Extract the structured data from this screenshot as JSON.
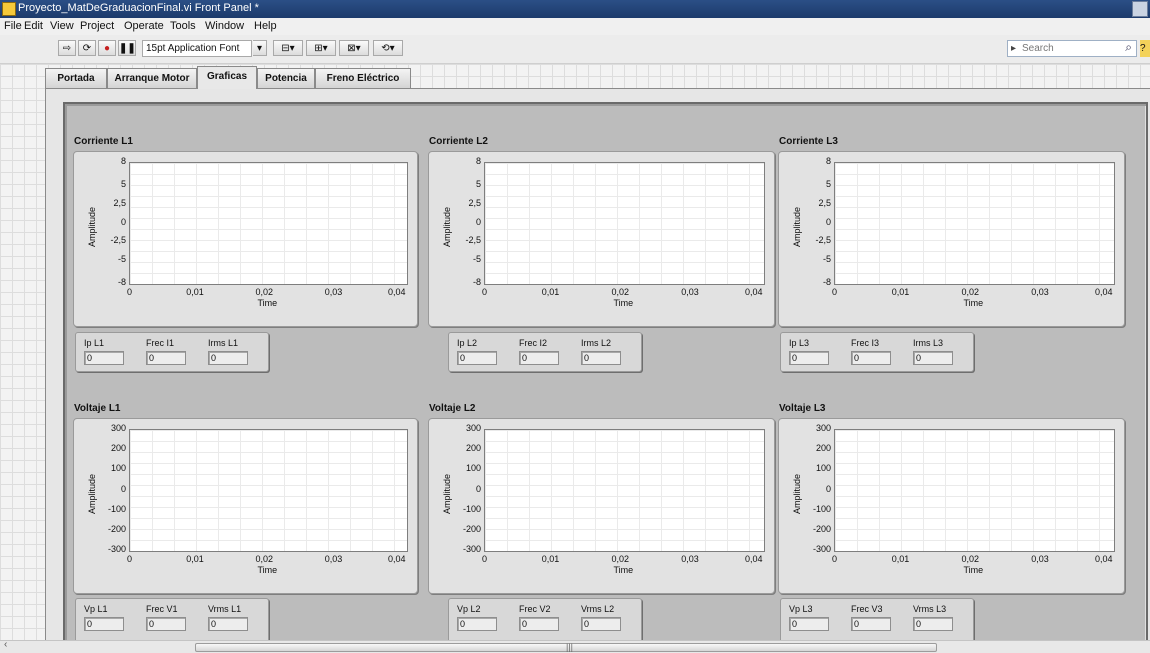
{
  "window": {
    "title": "Proyecto_MatDeGraduacionFinal.vi Front Panel *"
  },
  "menu": [
    "File",
    "Edit",
    "View",
    "Project",
    "Operate",
    "Tools",
    "Window",
    "Help"
  ],
  "toolbar": {
    "font": "15pt Application Font",
    "search_placeholder": "Search"
  },
  "tabs": [
    "Portada",
    "Arranque Motor",
    "Graficas",
    "Potencia",
    "Freno Eléctrico"
  ],
  "active_tab": "Graficas",
  "ticks": {
    "x": [
      "0",
      "0,01",
      "0,02",
      "0,03",
      "0,04"
    ],
    "y_current": [
      "8",
      "5",
      "2,5",
      "0",
      "-2,5",
      "-5",
      "-8"
    ],
    "y_voltage": [
      "300",
      "200",
      "100",
      "0",
      "-100",
      "-200",
      "-300"
    ],
    "xlabel": "Time",
    "ylabel": "Amplitude"
  },
  "current_graphs": [
    {
      "title": "Corriente L1",
      "labels": [
        "Ip L1",
        "Frec I1",
        "Irms L1"
      ],
      "values": [
        "0",
        "0",
        "0"
      ]
    },
    {
      "title": "Corriente L2",
      "labels": [
        "Ip L2",
        "Frec I2",
        "Irms L2"
      ],
      "values": [
        "0",
        "0",
        "0"
      ]
    },
    {
      "title": "Corriente L3",
      "labels": [
        "Ip L3",
        "Frec I3",
        "Irms L3"
      ],
      "values": [
        "0",
        "0",
        "0"
      ]
    }
  ],
  "voltage_graphs": [
    {
      "title": "Voltaje L1",
      "labels": [
        "Vp L1",
        "Frec V1",
        "Vrms L1"
      ],
      "values": [
        "0",
        "0",
        "0"
      ]
    },
    {
      "title": "Voltaje L2",
      "labels": [
        "Vp L2",
        "Frec V2",
        "Vrms L2"
      ],
      "values": [
        "0",
        "0",
        "0"
      ]
    },
    {
      "title": "Voltaje L3",
      "labels": [
        "Vp L3",
        "Frec V3",
        "Vrms L3"
      ],
      "values": [
        "0",
        "0",
        "0"
      ]
    }
  ],
  "chart_data": [
    {
      "type": "line",
      "title": "Corriente L1",
      "xlabel": "Time",
      "ylabel": "Amplitude",
      "xlim": [
        0,
        0.04
      ],
      "ylim": [
        -8,
        8
      ],
      "series": []
    },
    {
      "type": "line",
      "title": "Corriente L2",
      "xlabel": "Time",
      "ylabel": "Amplitude",
      "xlim": [
        0,
        0.04
      ],
      "ylim": [
        -8,
        8
      ],
      "series": []
    },
    {
      "type": "line",
      "title": "Corriente L3",
      "xlabel": "Time",
      "ylabel": "Amplitude",
      "xlim": [
        0,
        0.04
      ],
      "ylim": [
        -8,
        8
      ],
      "series": []
    },
    {
      "type": "line",
      "title": "Voltaje L1",
      "xlabel": "Time",
      "ylabel": "Amplitude",
      "xlim": [
        0,
        0.04
      ],
      "ylim": [
        -300,
        300
      ],
      "series": []
    },
    {
      "type": "line",
      "title": "Voltaje L2",
      "xlabel": "Time",
      "ylabel": "Amplitude",
      "xlim": [
        0,
        0.04
      ],
      "ylim": [
        -300,
        300
      ],
      "series": []
    },
    {
      "type": "line",
      "title": "Voltaje L3",
      "xlabel": "Time",
      "ylabel": "Amplitude",
      "xlim": [
        0,
        0.04
      ],
      "ylim": [
        -300,
        300
      ],
      "series": []
    }
  ]
}
